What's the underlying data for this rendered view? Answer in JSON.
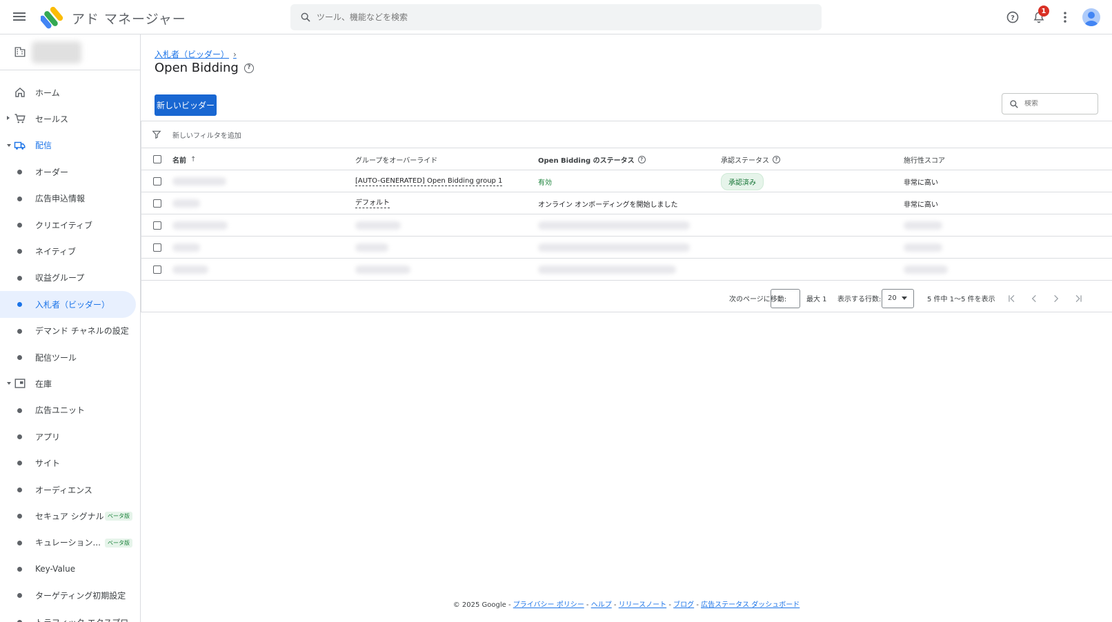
{
  "app": {
    "title": "アド マネージャー"
  },
  "search": {
    "placeholder": "ツール、機能などを検索"
  },
  "notifications": {
    "count": "1"
  },
  "sidebar": {
    "items": [
      {
        "label": "ホーム",
        "icon": "home-icon",
        "type": "top"
      },
      {
        "label": "セールス",
        "icon": "cart-icon",
        "type": "top",
        "caret": "right"
      },
      {
        "label": "配信",
        "icon": "truck-icon",
        "type": "top",
        "caret": "down",
        "expanded": true
      },
      {
        "label": "オーダー",
        "type": "sub"
      },
      {
        "label": "広告申込情報",
        "type": "sub"
      },
      {
        "label": "クリエイティブ",
        "type": "sub"
      },
      {
        "label": "ネイティブ",
        "type": "sub"
      },
      {
        "label": "収益グループ",
        "type": "sub"
      },
      {
        "label": "入札者（ビッダー）",
        "type": "sub",
        "active": true
      },
      {
        "label": "デマンド チャネルの設定",
        "type": "sub"
      },
      {
        "label": "配信ツール",
        "type": "sub"
      },
      {
        "label": "在庫",
        "icon": "inventory-icon",
        "type": "top",
        "caret": "down"
      },
      {
        "label": "広告ユニット",
        "type": "sub"
      },
      {
        "label": "アプリ",
        "type": "sub"
      },
      {
        "label": "サイト",
        "type": "sub"
      },
      {
        "label": "オーディエンス",
        "type": "sub"
      },
      {
        "label": "セキュア シグナル",
        "type": "sub",
        "badge": "ベータ版"
      },
      {
        "label": "キュレーション...",
        "type": "sub",
        "badge": "ベータ版"
      },
      {
        "label": "Key-Value",
        "type": "sub"
      },
      {
        "label": "ターゲティング初期設定",
        "type": "sub"
      },
      {
        "label": "トラフィック エクスプロ",
        "type": "sub"
      }
    ]
  },
  "breadcrumb": {
    "parent": "入札者（ビッダー）",
    "sep": "›"
  },
  "page": {
    "title": "Open Bidding"
  },
  "toolbar": {
    "new_button": "新しいビッダー",
    "search_placeholder": "検索"
  },
  "filter": {
    "label": "新しいフィルタを追加"
  },
  "table": {
    "headers": {
      "name": "名前",
      "sort_arrow": "↑",
      "group": "グループをオーバーライド",
      "ob_status": "Open Bidding のステータス",
      "approval": "承認ステータス",
      "score": "施行性スコア"
    },
    "rows": [
      {
        "group": "[AUTO-GENERATED] Open Bidding group 1",
        "ob_status": "有効",
        "approval": "承認済み",
        "score": "非常に高い"
      },
      {
        "group": "デフォルト",
        "ob_status": "オンライン オンボーディングを開始しました",
        "approval": "",
        "score": "非常に高い"
      },
      {
        "group": "",
        "ob_status": "",
        "approval": "",
        "score": ""
      },
      {
        "group": "",
        "ob_status": "",
        "approval": "",
        "score": ""
      },
      {
        "group": "",
        "ob_status": "",
        "approval": "",
        "score": ""
      }
    ]
  },
  "pager": {
    "goto_label": "次のページに移動:",
    "max_label": "最大 1",
    "rows_label": "表示する行数:",
    "rows_value": "20",
    "summary": "5 件中 1〜5 件を表示"
  },
  "footer": {
    "copyright": "© 2025 Google -",
    "links": [
      "プライバシー ポリシー",
      "ヘルプ",
      "リリースノート",
      "ブログ",
      "広告ステータス ダッシュボード"
    ],
    "sep": " - "
  }
}
